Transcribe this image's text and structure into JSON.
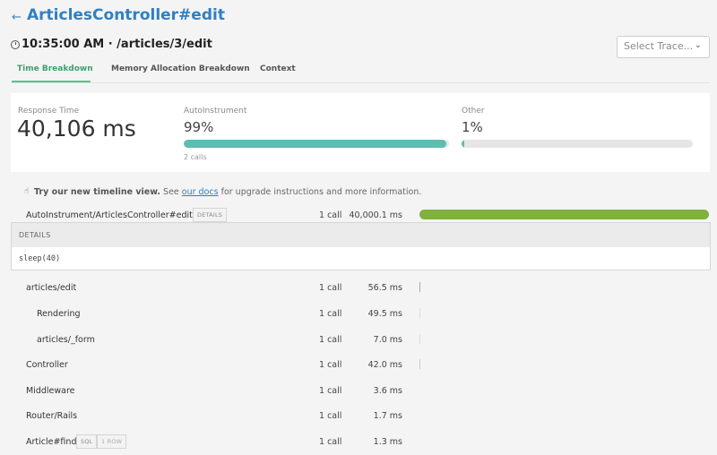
{
  "header": {
    "back_arrow": "←",
    "title": "ArticlesController#edit",
    "subtitle": "10:35:00 AM · /articles/3/edit",
    "select_placeholder": "Select Trace...",
    "select_chevron": "⌄"
  },
  "tabs": [
    {
      "label": "Time Breakdown",
      "active": true
    },
    {
      "label": "Memory Allocation Breakdown",
      "active": false
    },
    {
      "label": "Context",
      "active": false
    }
  ],
  "summary": {
    "response_label": "Response Time",
    "response_value": "40,106 ms",
    "auto_label": "AutoInstrument",
    "auto_value": "99%",
    "auto_fraction": 0.99,
    "auto_calls": "2 calls",
    "other_label": "Other",
    "other_value": "1%",
    "other_fraction": 0.01,
    "bar_color": "#5cbdb1"
  },
  "banner": {
    "icon": "☝",
    "bold": "Try our new timeline view.",
    "before_link": " See ",
    "link": "our docs",
    "after_link": " for upgrade instructions and more information."
  },
  "main_row": {
    "name": "AutoInstrument/ArticlesController#edit:22",
    "badge": "DETAILS",
    "calls": "1 call",
    "time": "40,000.1 ms",
    "fraction": 1.0,
    "bar_color": "#7fb13d"
  },
  "details": {
    "heading": "DETAILS",
    "code": "sleep(40)"
  },
  "rows": [
    {
      "name": "articles/edit",
      "calls": "1 call",
      "time": "56.5 ms"
    },
    {
      "name": "Rendering",
      "calls": "1 call",
      "time": "49.5 ms"
    },
    {
      "name": "articles/_form",
      "calls": "1 call",
      "time": "7.0 ms"
    },
    {
      "name": "Controller",
      "calls": "1 call",
      "time": "42.0 ms"
    },
    {
      "name": "Middleware",
      "calls": "1 call",
      "time": "3.6 ms"
    },
    {
      "name": "Router/Rails",
      "calls": "1 call",
      "time": "1.7 ms"
    },
    {
      "name": "Article#find",
      "calls": "1 call",
      "time": "1.3 ms",
      "badges": [
        "SQL",
        "1 ROW"
      ]
    }
  ]
}
